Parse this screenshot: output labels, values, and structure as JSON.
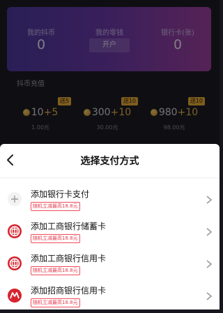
{
  "wallet": {
    "coins_label": "我的抖币",
    "coins_value": "0",
    "change_label": "我的零钱",
    "open_label": "开户",
    "cards_label": "银行卡(张)",
    "cards_value": "0"
  },
  "recharge": {
    "title": "抖币充值",
    "packs": [
      {
        "badge": "送5",
        "base": "10",
        "bonus": "+5",
        "price": "1.00元"
      },
      {
        "badge": "送10",
        "base": "300",
        "bonus": "+10",
        "price": "30.00元"
      },
      {
        "badge": "送10",
        "base": "980",
        "bonus": "+10",
        "price": "98.00元"
      }
    ]
  },
  "sheet": {
    "title": "选择支付方式",
    "options": [
      {
        "name": "添加银行卡支付",
        "promo": "随机立减最高18.8元",
        "icon": "plus-icon"
      },
      {
        "name": "添加工商银行储蓄卡",
        "promo": "随机立减最高18.8元",
        "icon": "icbc-logo-icon"
      },
      {
        "name": "添加工商银行信用卡",
        "promo": "随机立减最高18.8元",
        "icon": "icbc-logo-icon"
      },
      {
        "name": "添加招商银行信用卡",
        "promo": "随机立减最高18.8元",
        "icon": "cmb-logo-icon"
      }
    ]
  },
  "colors": {
    "card_gradient_start": "#4b3a9c",
    "card_gradient_end": "#9c3f9c",
    "promo_red": "#e33a4c",
    "coin_gold": "#e4b04a"
  }
}
